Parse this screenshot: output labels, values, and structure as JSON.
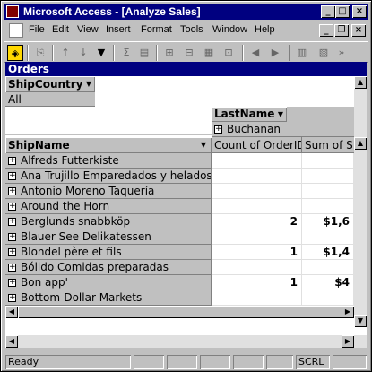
{
  "window": {
    "title": "Microsoft Access - [Analyze Sales]",
    "minimize": "_",
    "maximize": "□",
    "close": "×",
    "doc_minimize": "_",
    "doc_restore": "❐",
    "doc_close": "×"
  },
  "menu": [
    "File",
    "Edit",
    "View",
    "Insert",
    "Format",
    "Tools",
    "Window",
    "Help"
  ],
  "pivot": {
    "title": "Orders",
    "filter_field": "ShipCountry",
    "filter_value": "All",
    "column_field": "LastName",
    "column_item": "Buchanan",
    "row_field": "ShipName",
    "data_headers": [
      "Count of OrderID",
      "Sum of S"
    ],
    "rows": [
      {
        "name": "Alfreds Futterkiste",
        "count": "",
        "sum": ""
      },
      {
        "name": "Ana Trujillo Emparedados y helados",
        "count": "",
        "sum": ""
      },
      {
        "name": "Antonio Moreno Taquería",
        "count": "",
        "sum": ""
      },
      {
        "name": "Around the Horn",
        "count": "",
        "sum": ""
      },
      {
        "name": "Berglunds snabbköp",
        "count": "2",
        "sum": "$1,6"
      },
      {
        "name": "Blauer See Delikatessen",
        "count": "",
        "sum": ""
      },
      {
        "name": "Blondel père et fils",
        "count": "1",
        "sum": "$1,4"
      },
      {
        "name": "Bólido Comidas preparadas",
        "count": "",
        "sum": ""
      },
      {
        "name": "Bon app'",
        "count": "1",
        "sum": "$4"
      },
      {
        "name": "Bottom-Dollar Markets",
        "count": "",
        "sum": ""
      }
    ]
  },
  "status": {
    "text": "Ready",
    "scrl": "SCRL"
  },
  "icons": {
    "dropdown": "▼",
    "expand": "+",
    "scroll_up": "▲",
    "scroll_down": "▼",
    "scroll_left": "◀",
    "scroll_right": "▶"
  }
}
